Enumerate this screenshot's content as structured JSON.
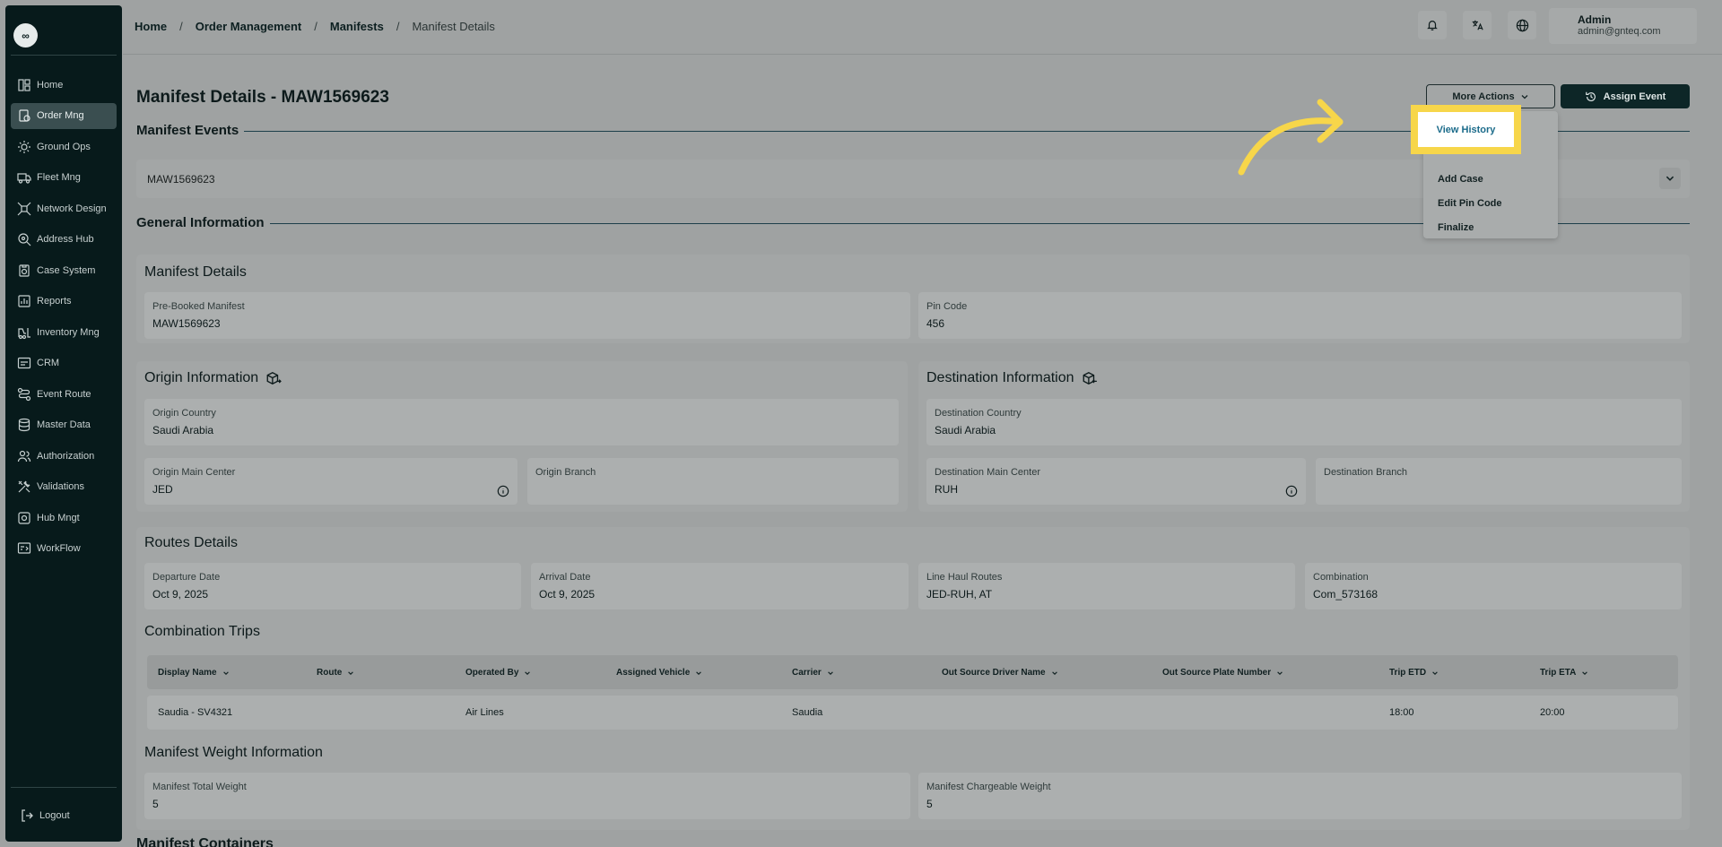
{
  "colors": {
    "sidebar": "#071a1b",
    "accent_highlight": "#f7d64a",
    "link_blue": "#1b6b8a",
    "primary_button": "#0d2627"
  },
  "sidebar": {
    "logo": "∞",
    "items": [
      {
        "label": "Home",
        "icon": "dashboard-icon"
      },
      {
        "label": "Order Mng",
        "icon": "order-icon",
        "active": true
      },
      {
        "label": "Ground Ops",
        "icon": "sun-gear-icon"
      },
      {
        "label": "Fleet Mng",
        "icon": "truck-icon"
      },
      {
        "label": "Network Design",
        "icon": "network-icon"
      },
      {
        "label": "Address Hub",
        "icon": "map-pin-icon"
      },
      {
        "label": "Case System",
        "icon": "case-icon"
      },
      {
        "label": "Reports",
        "icon": "report-icon"
      },
      {
        "label": "Inventory Mng",
        "icon": "forklift-icon"
      },
      {
        "label": "CRM",
        "icon": "crm-icon"
      },
      {
        "label": "Event Route",
        "icon": "route-icon"
      },
      {
        "label": "Master Data",
        "icon": "database-icon"
      },
      {
        "label": "Authorization",
        "icon": "users-icon"
      },
      {
        "label": "Validations",
        "icon": "tools-icon"
      },
      {
        "label": "Hub Mngt",
        "icon": "hub-icon"
      },
      {
        "label": "WorkFlow",
        "icon": "workflow-icon"
      }
    ],
    "logout": "Logout"
  },
  "breadcrumb": [
    "Home",
    "Order Management",
    "Manifests",
    "Manifest Details"
  ],
  "user": {
    "name": "Admin",
    "email": "admin@gnteq.com"
  },
  "page": {
    "title": "Manifest Details - MAW1569623",
    "more_actions": "More Actions",
    "assign_event": "Assign Event"
  },
  "dropdown": {
    "highlighted": "View History",
    "items": [
      "Add Case",
      "Edit Pin Code",
      "Finalize"
    ]
  },
  "sections": {
    "events": "Manifest Events",
    "events_value": "MAW1569623",
    "general": "General Information"
  },
  "manifest_details": {
    "title": "Manifest Details",
    "prebooked_label": "Pre-Booked Manifest",
    "prebooked_value": "MAW1569623",
    "pin_label": "Pin Code",
    "pin_value": "456"
  },
  "origin": {
    "title": "Origin Information",
    "country_label": "Origin Country",
    "country_value": "Saudi Arabia",
    "main_center_label": "Origin Main Center",
    "main_center_value": "JED",
    "branch_label": "Origin Branch",
    "branch_value": ""
  },
  "destination": {
    "title": "Destination Information",
    "country_label": "Destination Country",
    "country_value": "Saudi Arabia",
    "main_center_label": "Destination Main Center",
    "main_center_value": "RUH",
    "branch_label": "Destination Branch",
    "branch_value": ""
  },
  "routes": {
    "title": "Routes Details",
    "departure_label": "Departure Date",
    "departure_value": "Oct 9, 2025",
    "arrival_label": "Arrival Date",
    "arrival_value": "Oct 9, 2025",
    "linehaul_label": "Line Haul Routes",
    "linehaul_value": "JED-RUH, AT",
    "combination_label": "Combination",
    "combination_value": "Com_573168"
  },
  "trips": {
    "title": "Combination Trips",
    "columns": [
      "Display Name",
      "Route",
      "Operated By",
      "Assigned Vehicle",
      "Carrier",
      "Out Source Driver Name",
      "Out Source Plate Number",
      "Trip ETD",
      "Trip ETA"
    ],
    "rows": [
      [
        "Saudia - SV4321",
        "",
        "Air Lines",
        "",
        "Saudia",
        "",
        "",
        "18:00",
        "20:00"
      ]
    ]
  },
  "weight": {
    "title": "Manifest Weight Information",
    "total_label": "Manifest Total Weight",
    "total_value": "5",
    "chargeable_label": "Manifest Chargeable Weight",
    "chargeable_value": "5"
  },
  "next_section": "Manifest Containers"
}
